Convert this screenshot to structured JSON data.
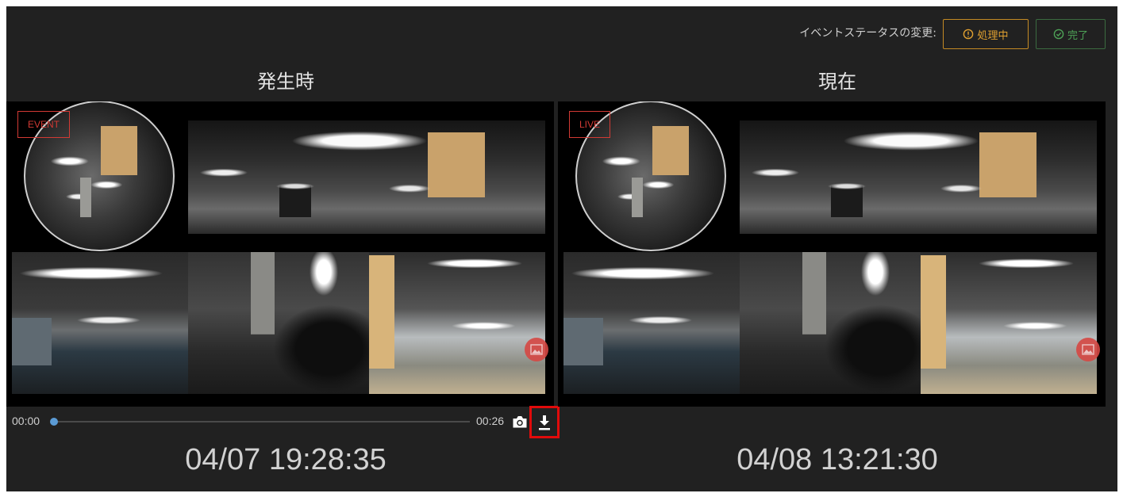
{
  "header": {
    "status_label": "イベントステータスの変更:",
    "processing_button": {
      "label": "処理中",
      "icon": "exclamation-circle-icon",
      "color": "#e0a030",
      "border": "#c48a24"
    },
    "complete_button": {
      "label": "完了",
      "icon": "check-circle-icon",
      "color": "#4ea257",
      "border": "#3b6b40"
    }
  },
  "panels": [
    {
      "title": "発生時",
      "badge": "EVENT",
      "timestamp": "04/07 19:28:35"
    },
    {
      "title": "現在",
      "badge": "LIVE",
      "timestamp": "04/08 13:21:30"
    }
  ],
  "player": {
    "current_time": "00:00",
    "duration": "00:26",
    "progress": 0,
    "snapshot_icon": "camera-icon",
    "download_icon": "download-icon",
    "media_icon": "image-icon"
  },
  "colors": {
    "background": "#212121",
    "badge": "#d23a34",
    "accent": "#5b9bd5",
    "highlight": "#e10b0b",
    "media_button": "#d64844"
  }
}
